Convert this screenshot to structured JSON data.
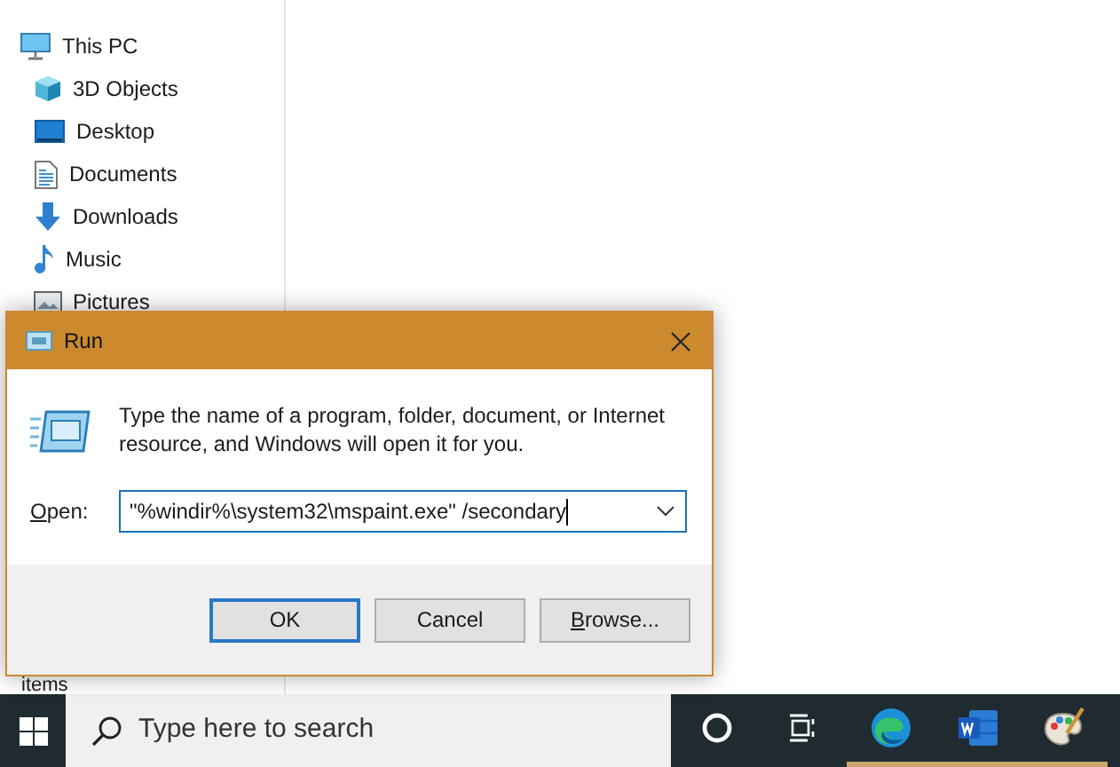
{
  "explorer": {
    "nav": [
      {
        "label": "This PC",
        "kind": "pc",
        "children": [
          {
            "label": "3D Objects",
            "kind": "cube"
          },
          {
            "label": "Desktop",
            "kind": "desktop"
          },
          {
            "label": "Documents",
            "kind": "document"
          },
          {
            "label": "Downloads",
            "kind": "download"
          },
          {
            "label": "Music",
            "kind": "music"
          },
          {
            "label": "Pictures",
            "kind": "pictures"
          }
        ]
      }
    ],
    "status_bar": "items"
  },
  "run_dialog": {
    "title": "Run",
    "description": "Type the name of a program, folder, document, or Internet resource, and Windows will open it for you.",
    "open_label": {
      "access_key": "O",
      "rest": "pen:"
    },
    "command": "\"%windir%\\system32\\mspaint.exe\" /secondary",
    "buttons": [
      {
        "label": "OK",
        "default": true
      },
      {
        "label": "Cancel",
        "default": false
      },
      {
        "access_key": "B",
        "rest": "rowse...",
        "default": false
      }
    ]
  },
  "taskbar": {
    "search_placeholder": "Type here to search",
    "apps": [
      {
        "kind": "cortana",
        "running": false
      },
      {
        "kind": "task-view",
        "running": false
      },
      {
        "kind": "edge",
        "running": true
      },
      {
        "kind": "word",
        "running": true
      },
      {
        "kind": "paint",
        "running": true
      }
    ]
  }
}
